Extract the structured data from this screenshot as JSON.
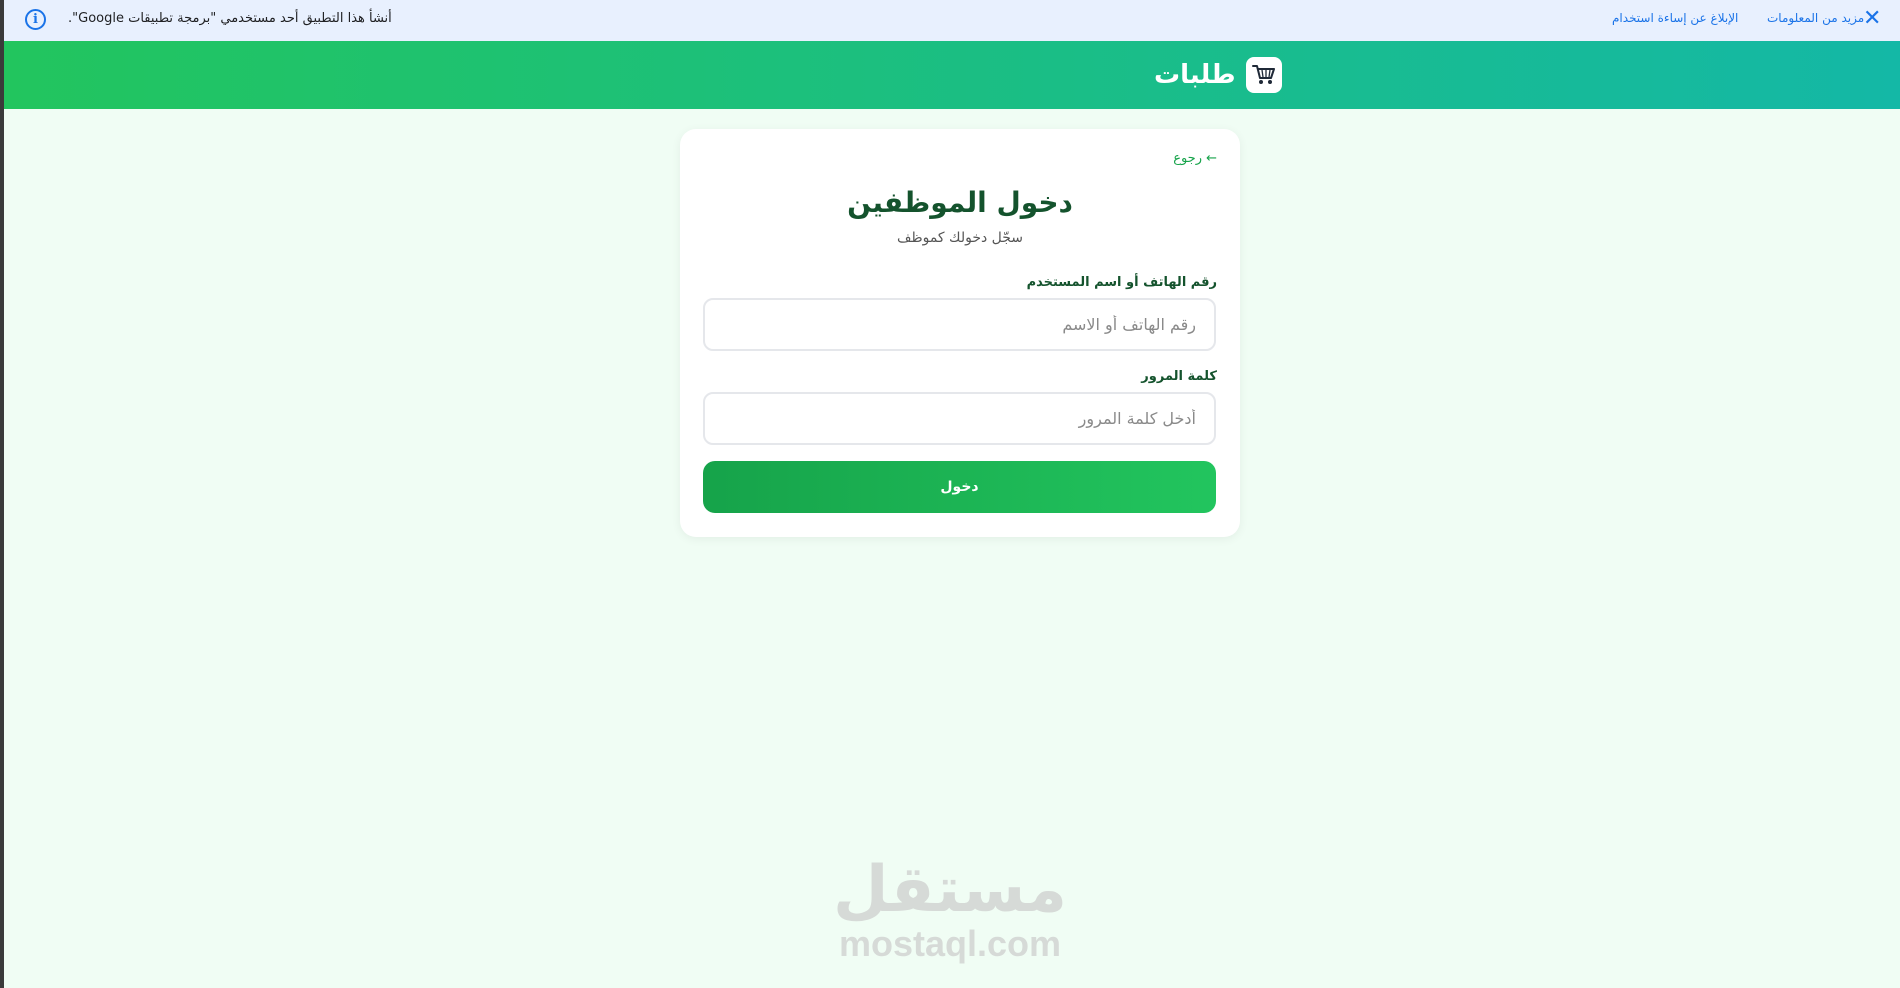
{
  "banner": {
    "message": "أنشأ هذا التطبيق أحد مستخدمي \"برمجة تطبيقات Google\".",
    "report_link": "الإبلاغ عن إساءة استخدام",
    "more_link": "مزيد من المعلومات",
    "info_icon": "info-icon",
    "close_icon": "close-icon",
    "close_glyph": "✕",
    "info_glyph": "i"
  },
  "header": {
    "brand_title": "طلبات",
    "logo_icon": "cart-icon",
    "gradient_start": "#22c55e",
    "gradient_end": "#14b8a6"
  },
  "login": {
    "back_link": "← رجوع",
    "title": "دخول الموظفين",
    "subtitle": "سجّل دخولك كموظف",
    "username_label": "رقم الهاتف أو اسم المستخدم",
    "username_placeholder": "رقم الهاتف أو الاسم",
    "username_value": "",
    "password_label": "كلمة المرور",
    "password_placeholder": "أدخل كلمة المرور",
    "password_value": "",
    "submit_label": "دخول"
  },
  "watermark": {
    "arabic": "مستقل",
    "latin": "mostaql.com"
  },
  "colors": {
    "accent": "#16a34a",
    "title": "#14532d",
    "background": "#f0fdf4"
  }
}
